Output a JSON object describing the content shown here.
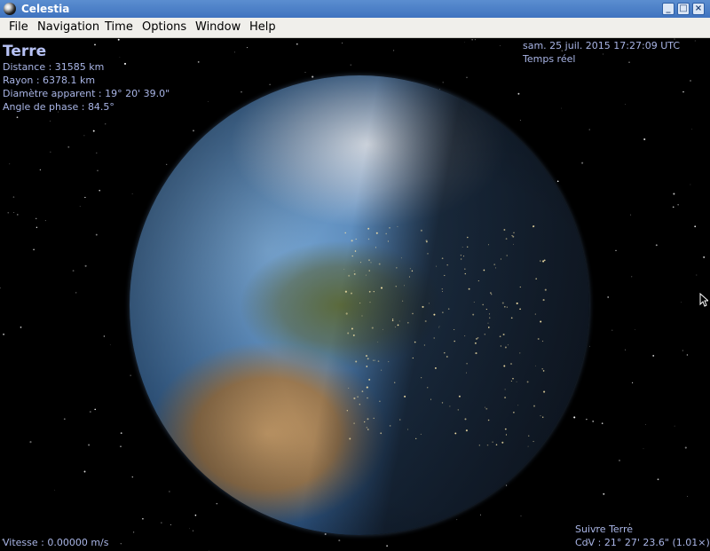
{
  "window": {
    "title": "Celestia"
  },
  "window_controls": {
    "minimize": "_",
    "maximize": "□",
    "close": "×"
  },
  "menu": {
    "items": [
      "File",
      "Navigation",
      "Time",
      "Options",
      "Window",
      "Help"
    ]
  },
  "object_info": {
    "name": "Terre",
    "distance": "Distance : 31585 km",
    "radius": "Rayon : 6378.1 km",
    "apparent_diameter": "Diamètre apparent : 19° 20' 39.0\"",
    "phase_angle": "Angle de phase : 84.5°"
  },
  "time_info": {
    "datetime": "sam. 25 juil. 2015 17:27:09 UTC",
    "mode": "Temps réel"
  },
  "speed": "Vitesse : 0.00000 m/s",
  "view_info": {
    "follow": "Suivre Terre",
    "fov": "CdV : 21° 27' 23.6\" (1.01×)"
  },
  "colors": {
    "hud_text": "#a9b5e6",
    "title_bar": "#4a7fc8",
    "menu_bg": "#f0efeb"
  }
}
